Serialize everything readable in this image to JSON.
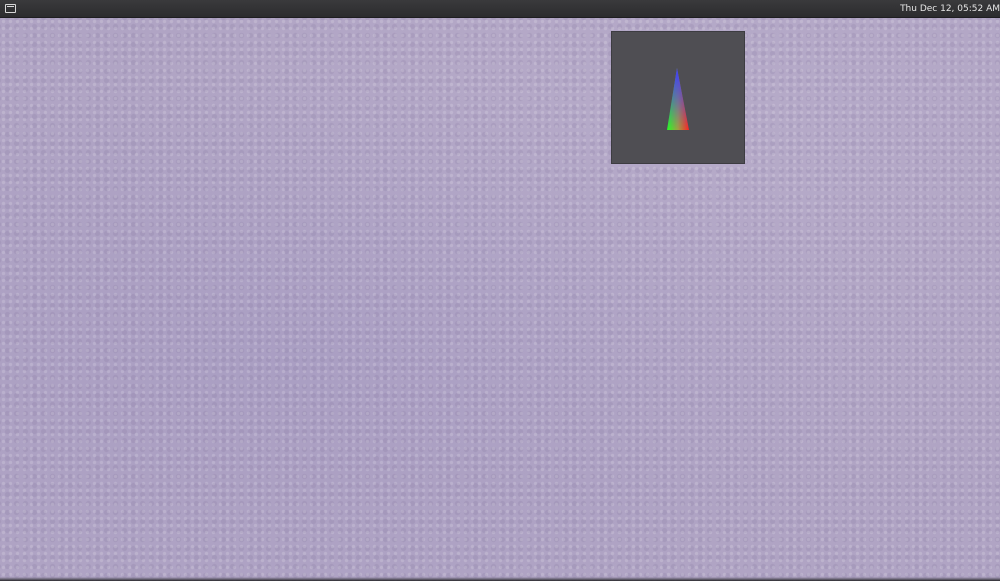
{
  "topbar": {
    "menu_icon": "window-menu-icon",
    "clock_text": "Thu Dec 12, 05:52 AM"
  },
  "desktop": {
    "wallpaper": "lavender-hexagon-pattern",
    "wallpaper_color": "#b0a4c4"
  },
  "gl_window": {
    "background_color": "#4f4e53",
    "triangle_colors": {
      "apex": "#3b3bff",
      "bottom_left": "#22ff22",
      "bottom_right": "#ff2222"
    }
  }
}
